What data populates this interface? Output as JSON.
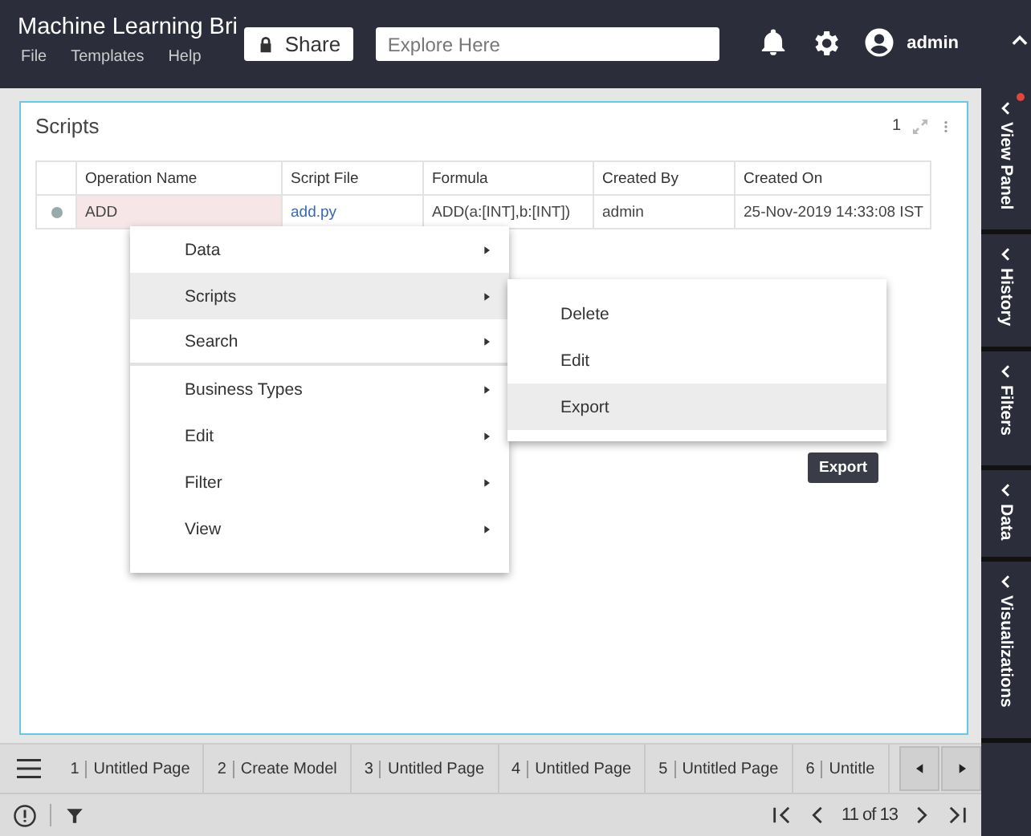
{
  "header": {
    "title": "Machine Learning Bri",
    "menu": [
      "File",
      "Templates",
      "Help"
    ],
    "share_button": "Share",
    "search": {
      "placeholder": "Explore Here"
    },
    "user": "admin"
  },
  "panel": {
    "title": "Scripts",
    "count": "1",
    "table": {
      "columns": [
        "Operation Name",
        "Script File",
        "Formula",
        "Created By",
        "Created On"
      ],
      "rows": [
        {
          "selected": true,
          "cells": [
            "ADD",
            "add.py",
            "ADD(a:[INT],b:[INT])",
            "admin",
            "25-Nov-2019 14:33:08 IST"
          ]
        }
      ]
    }
  },
  "context_menu": {
    "items": [
      {
        "label": "Data",
        "selected": false,
        "divider_after": false
      },
      {
        "label": "Scripts",
        "selected": true,
        "divider_after": false
      },
      {
        "label": "Search",
        "selected": false,
        "divider_after": true
      },
      {
        "label": "Business Types",
        "selected": false,
        "divider_after": false
      },
      {
        "label": "Edit",
        "selected": false,
        "divider_after": false
      },
      {
        "label": "Filter",
        "selected": false,
        "divider_after": false
      },
      {
        "label": "View",
        "selected": false,
        "divider_after": false
      }
    ],
    "submenu": [
      {
        "label": "Delete",
        "selected": false
      },
      {
        "label": "Edit",
        "selected": false
      },
      {
        "label": "Export",
        "selected": true
      }
    ],
    "tooltip": "Export"
  },
  "side_tabs": [
    {
      "label": "View Panel",
      "notification": true
    },
    {
      "label": "History",
      "notification": false
    },
    {
      "label": "Filters",
      "notification": false
    },
    {
      "label": "Data",
      "notification": false
    },
    {
      "label": "Visualizations",
      "notification": false
    }
  ],
  "page_tabs": [
    {
      "number": "1",
      "label": "Untitled Page"
    },
    {
      "number": "2",
      "label": "Create Model"
    },
    {
      "number": "3",
      "label": "Untitled Page"
    },
    {
      "number": "4",
      "label": "Untitled Page"
    },
    {
      "number": "5",
      "label": "Untitled Page"
    },
    {
      "number": "6",
      "label": "Untitle"
    }
  ],
  "status_bar": {
    "pager": "11 of 13"
  }
}
